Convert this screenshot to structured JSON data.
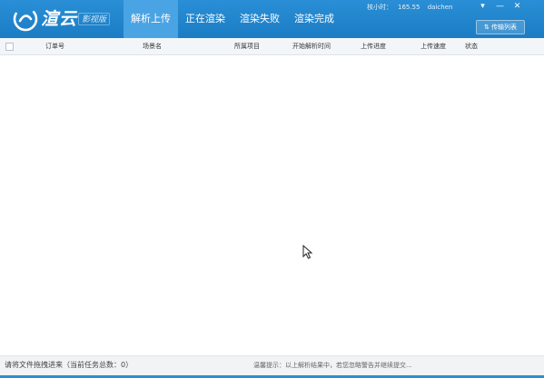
{
  "app": {
    "brand": "渲云",
    "edition": "影视版"
  },
  "tabs": [
    {
      "label": "解析上传",
      "active": true
    },
    {
      "label": "正在渲染",
      "active": false
    },
    {
      "label": "渲染失败",
      "active": false
    },
    {
      "label": "渲染完成",
      "active": false
    }
  ],
  "account": {
    "balance_label": "核小时：",
    "balance_value": "165.55",
    "username": "daichen"
  },
  "window_controls": {
    "menu": "▾",
    "minimize": "—",
    "close": "✕"
  },
  "transfer_button": {
    "label": "传输列表"
  },
  "table": {
    "columns": [
      "订单号",
      "场景名",
      "所属项目",
      "开始解析时间",
      "上传进度",
      "上传速度",
      "状态"
    ],
    "rows": []
  },
  "status": {
    "drop_hint": "请将文件拖拽进来（当前任务总数：0）",
    "notice": "温馨提示：以上解析结果中，若您忽略警告并继续提交..."
  },
  "colors": {
    "header": "#1b7cc4",
    "active_tab": "#4aa3e3",
    "table_header_bg": "#f3f6f9"
  }
}
